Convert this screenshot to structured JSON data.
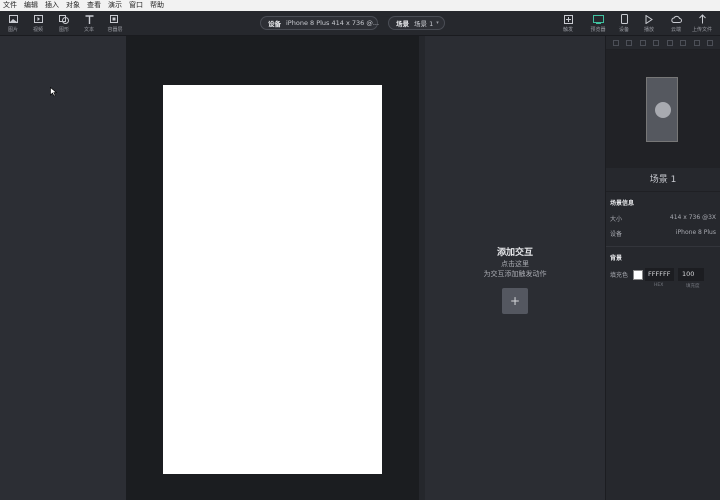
{
  "menu": [
    "文件",
    "编辑",
    "插入",
    "对象",
    "查看",
    "演示",
    "窗口",
    "帮助"
  ],
  "toolbar_left": [
    {
      "label": "图片",
      "icon": "image-icon"
    },
    {
      "label": "视频",
      "icon": "video-icon"
    },
    {
      "label": "图形",
      "icon": "shape-icon"
    },
    {
      "label": "文本",
      "icon": "text-icon"
    },
    {
      "label": "容器层",
      "icon": "container-icon"
    }
  ],
  "device_pill": {
    "label": "设备",
    "value": "iPhone 8 Plus  414 x 736 @..."
  },
  "scene_pill": {
    "label": "场景",
    "value": "场景 1"
  },
  "toolbar_right": [
    {
      "label": "触发",
      "icon": "trigger-icon"
    },
    {
      "label": "预览器",
      "icon": "previewer-icon"
    },
    {
      "label": "设备",
      "icon": "device-icon"
    },
    {
      "label": "播放",
      "icon": "play-icon"
    },
    {
      "label": "云端",
      "icon": "cloud-icon"
    },
    {
      "label": "上传文件",
      "icon": "upload-icon"
    }
  ],
  "interaction": {
    "title": "添加交互",
    "line1": "点击这里",
    "line2": "为交互添加触发动作",
    "add": "+"
  },
  "inspector": {
    "scene_name": "场景 1",
    "info_title": "场景信息",
    "size_label": "大小",
    "size_value": "414 x 736 @3X",
    "device_label": "设备",
    "device_value": "iPhone 8 Plus",
    "bg_title": "背景",
    "fill_label": "填充色",
    "fill_hex": "FFFFFF",
    "fill_opacity": "100",
    "hex_sub": "HEX",
    "opacity_sub": "填充度",
    "colors": {
      "fill": "#ffffff"
    }
  }
}
